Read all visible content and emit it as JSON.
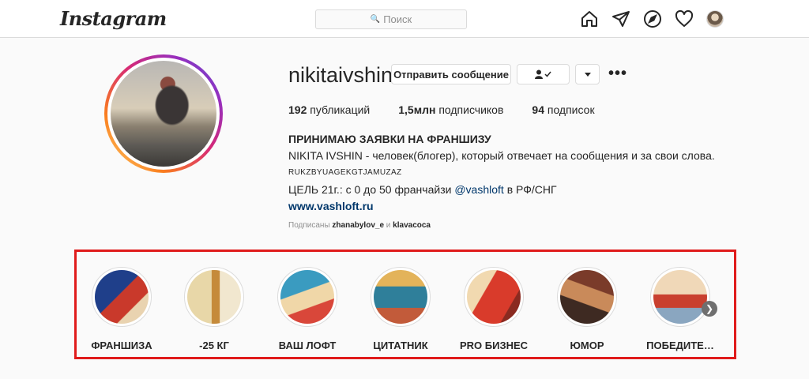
{
  "nav": {
    "logo": "Instagram",
    "search_placeholder": "Поиск",
    "icons": [
      "home-icon",
      "direct-icon",
      "explore-icon",
      "heart-icon",
      "profile-avatar"
    ]
  },
  "profile": {
    "username": "nikitaivshin",
    "message_button": "Отправить сообщение",
    "stats": {
      "posts_count": "192",
      "posts_label": "публикаций",
      "followers_count": "1,5млн",
      "followers_label": "подписчиков",
      "following_count": "94",
      "following_label": "подписок"
    },
    "bio": {
      "title": "ПРИНИМАЮ ЗАЯВКИ НА ФРАНШИЗУ",
      "line1": "NIKITA IVSHIN - человек(блогер), который отвечает на сообщения и за свои слова.",
      "code": "RUKZBYUAGEKGTJAMUZAZ",
      "goal_prefix": "ЦЕЛЬ 21г.: с 0 до 50 франчайзи",
      "goal_mention": "@vashloft",
      "goal_suffix": "в РФ/СНГ",
      "website": "www.vashloft.ru"
    },
    "followed_by": {
      "prefix": "Подписаны",
      "user1": "zhanabylov_e",
      "joiner": "и",
      "user2": "klavacoca"
    }
  },
  "highlights": [
    {
      "label": "ФРАНШИЗА",
      "color1": "#1f3f8a",
      "color2": "#c9392b"
    },
    {
      "label": "-25 КГ",
      "color1": "#e8d7a8",
      "color2": "#c58a3a"
    },
    {
      "label": "ВАШ ЛОФТ",
      "color1": "#3a9bc0",
      "color2": "#d9473a"
    },
    {
      "label": "ЦИТАТНИК",
      "color1": "#2f7f9a",
      "color2": "#e3b35a"
    },
    {
      "label": "PRO БИЗНЕС",
      "color1": "#d93b2b",
      "color2": "#f1d9b0"
    },
    {
      "label": "ЮМОР",
      "color1": "#7a3b2a",
      "color2": "#c98a5a"
    },
    {
      "label": "ПОБЕДИТЕ…",
      "color1": "#f0d8b8",
      "color2": "#c9402f"
    }
  ]
}
